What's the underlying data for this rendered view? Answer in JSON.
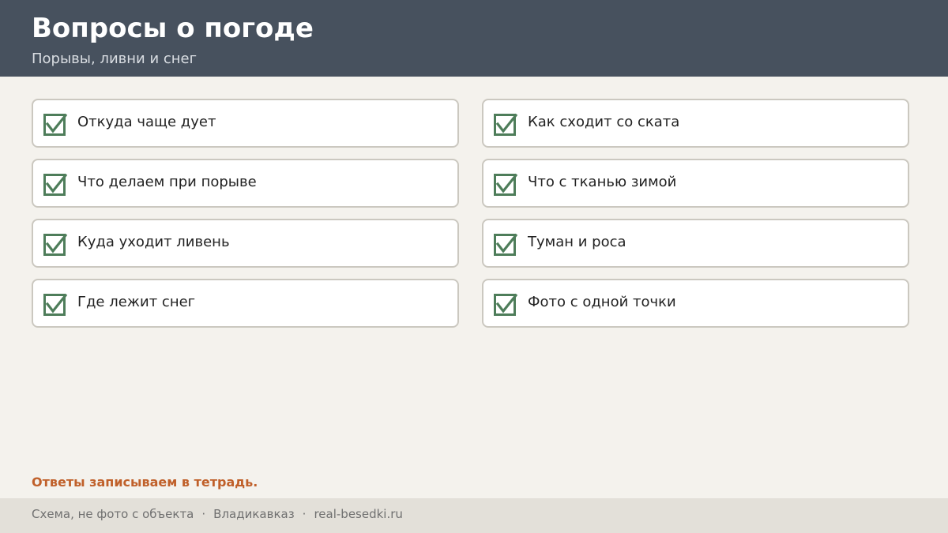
{
  "header": {
    "title": "Вопросы о погоде",
    "subtitle": "Порывы, ливни и снег"
  },
  "items": [
    {
      "label": "Откуда чаще дует",
      "checked": true
    },
    {
      "label": "Как сходит со ската",
      "checked": true
    },
    {
      "label": "Что делаем при порыве",
      "checked": true
    },
    {
      "label": "Что с тканью зимой",
      "checked": true
    },
    {
      "label": "Куда уходит ливень",
      "checked": true
    },
    {
      "label": "Туман и роса",
      "checked": true
    },
    {
      "label": "Где лежит снег",
      "checked": true
    },
    {
      "label": "Фото с одной точки",
      "checked": true
    }
  ],
  "note": "Ответы записываем в тетрадь.",
  "footer": {
    "parts": [
      "Схема, не фото с объекта",
      "Владикавказ",
      "real-besedki.ru"
    ],
    "separator": "·"
  },
  "colors": {
    "header_bg": "#47515e",
    "page_bg": "#f4f2ed",
    "check": "#4e7d5a",
    "accent": "#c0602a",
    "footer_bg": "#e3e0d9"
  },
  "icons": {
    "checkbox": "checkbox-checked-icon"
  }
}
